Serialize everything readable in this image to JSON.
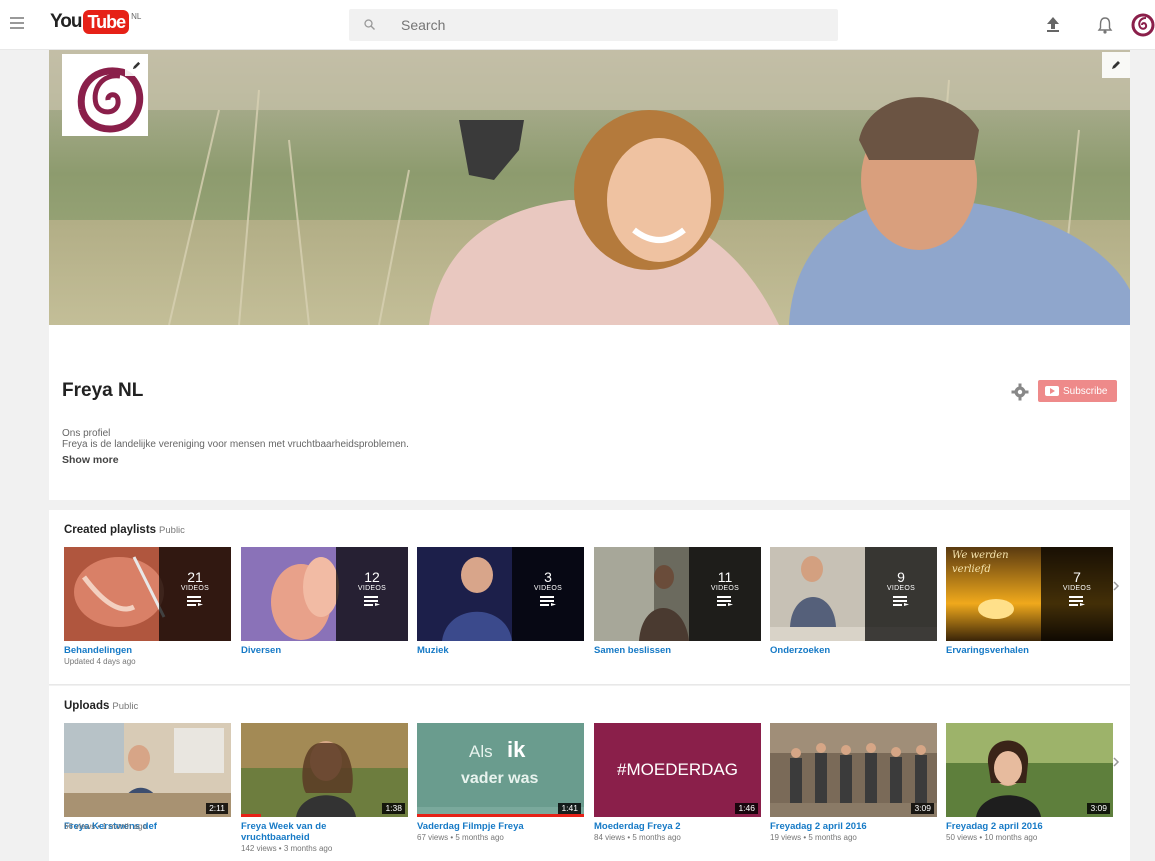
{
  "masthead": {
    "logo_you": "You",
    "logo_tube": "Tube",
    "logo_region": "NL",
    "search_placeholder": "Search"
  },
  "channel": {
    "name": "Freya NL",
    "subscribe_label": "Subscribe",
    "about_heading": "Ons profiel",
    "about_text": "Freya is de landelijke vereniging voor mensen met vruchtbaarheidsproblemen.",
    "show_more": "Show more"
  },
  "playlists": {
    "title": "Created playlists",
    "visibility": "Public",
    "videos_label": "VIDEOS",
    "items": [
      {
        "title": "Behandelingen",
        "count": "21",
        "meta": "Updated 4 days ago"
      },
      {
        "title": "Diversen",
        "count": "12",
        "meta": ""
      },
      {
        "title": "Muziek",
        "count": "3",
        "meta": ""
      },
      {
        "title": "Samen beslissen",
        "count": "11",
        "meta": ""
      },
      {
        "title": "Onderzoeken",
        "count": "9",
        "meta": ""
      },
      {
        "title": "Ervaringsverhalen",
        "count": "7",
        "meta": "",
        "thumb_text_1": "We werden",
        "thumb_text_2": "verliefd"
      }
    ]
  },
  "uploads": {
    "title": "Uploads",
    "visibility": "Public",
    "items": [
      {
        "title_1": "Freya Kerstwens def",
        "title_2": "",
        "meta": "66 views • 1 month ago",
        "duration": "2:11"
      },
      {
        "title_1": "Freya Week van de",
        "title_2": "vruchtbaarheid",
        "meta": "142 views • 3 months ago",
        "duration": "1:38"
      },
      {
        "title_1": "Vaderdag Filmpje Freya",
        "title_2": "",
        "meta": "67 views • 5 months ago",
        "duration": "1:41",
        "thumb_text_1": "Als",
        "thumb_text_bold": "ik",
        "thumb_text_2": "vader was"
      },
      {
        "title_1": "Moederdag Freya 2",
        "title_2": "",
        "meta": "84 views • 5 months ago",
        "duration": "1:46",
        "thumb_text_1": "#MOEDERDAG"
      },
      {
        "title_1": "Freyadag 2 april 2016",
        "title_2": "",
        "meta": "19 views • 5 months ago",
        "duration": "3:09"
      },
      {
        "title_1": "Freyadag 2 april 2016",
        "title_2": "",
        "meta": "50 views • 10 months ago",
        "duration": "3:09"
      }
    ]
  },
  "colors": {
    "brand_red": "#e62117",
    "link_blue": "#167ac6",
    "subscribe_disabled": "#ee8a8a",
    "freya_purple": "#8a1f4a"
  }
}
